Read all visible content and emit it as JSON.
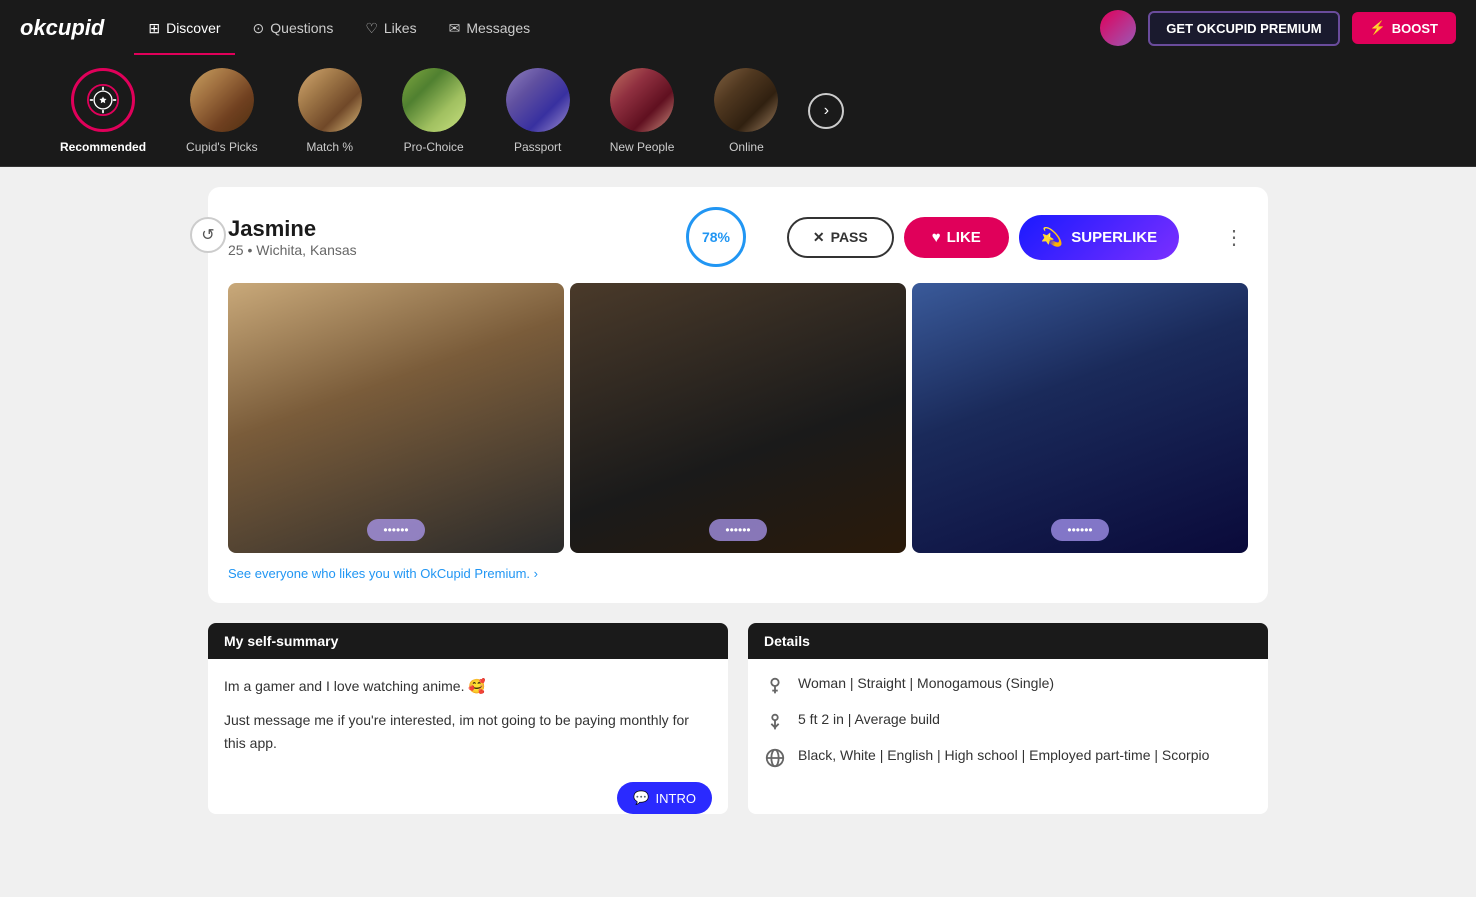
{
  "brand": {
    "logo": "okcupid"
  },
  "nav": {
    "items": [
      {
        "id": "discover",
        "label": "Discover",
        "icon": "grid-icon",
        "active": true
      },
      {
        "id": "questions",
        "label": "Questions",
        "icon": "question-icon",
        "active": false
      },
      {
        "id": "likes",
        "label": "Likes",
        "icon": "heart-icon",
        "active": false
      },
      {
        "id": "messages",
        "label": "Messages",
        "icon": "message-icon",
        "active": false
      }
    ],
    "premium_btn": "GET OKCUPID PREMIUM",
    "boost_btn": "BOOST"
  },
  "categories": [
    {
      "id": "recommended",
      "label": "Recommended",
      "active": true,
      "special": true
    },
    {
      "id": "cupids-picks",
      "label": "Cupid's Picks",
      "active": false
    },
    {
      "id": "match",
      "label": "Match %",
      "active": false
    },
    {
      "id": "pro-choice",
      "label": "Pro-Choice",
      "active": false
    },
    {
      "id": "passport",
      "label": "Passport",
      "active": false
    },
    {
      "id": "new-people",
      "label": "New People",
      "active": false
    },
    {
      "id": "online",
      "label": "Online",
      "active": false
    }
  ],
  "profile": {
    "name": "Jasmine",
    "age": "25",
    "location": "Wichita, Kansas",
    "match_percent": "78%",
    "pass_label": "PASS",
    "like_label": "LIKE",
    "superlike_label": "SUPERLIKE",
    "premium_link": "See everyone who likes you with OkCupid Premium.",
    "self_summary_header": "My self-summary",
    "self_summary_line1": "Im a gamer and I love watching anime. 🥰",
    "self_summary_line2": "Just message me if you're interested, im not going to be paying monthly for this app.",
    "intro_btn": "INTRO",
    "details_header": "Details",
    "details": [
      {
        "icon": "gender-icon",
        "text": "Woman | Straight | Monogamous (Single)"
      },
      {
        "icon": "height-icon",
        "text": "5 ft 2 in | Average build"
      },
      {
        "icon": "globe-icon",
        "text": "Black, White | English | High school | Employed part-time | Scorpio"
      }
    ]
  }
}
